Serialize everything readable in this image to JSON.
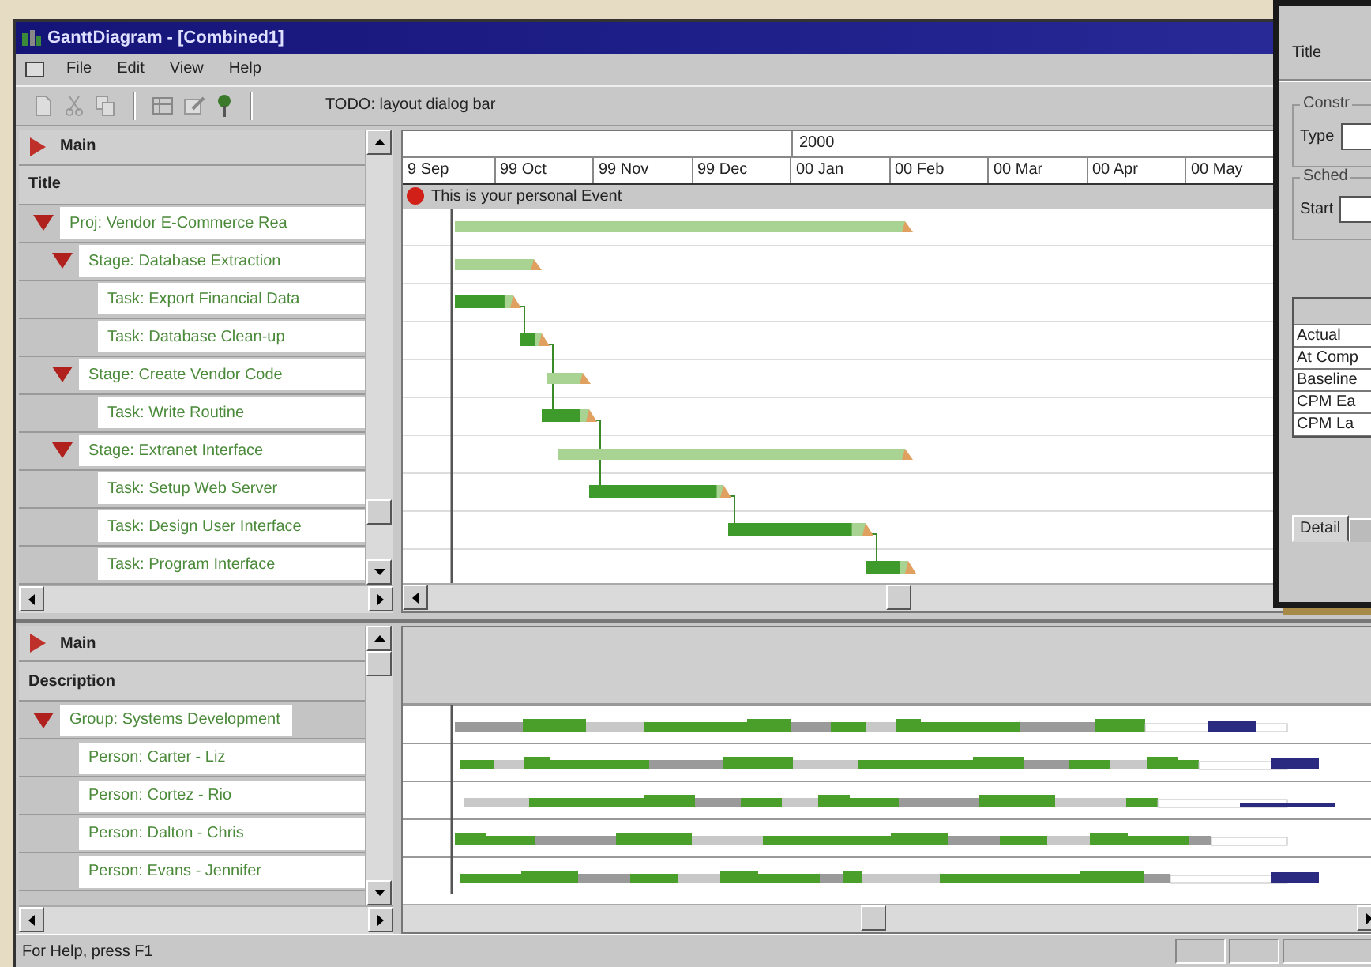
{
  "window": {
    "title": "GanttDiagram - [Combined1]"
  },
  "menu": [
    "File",
    "Edit",
    "View",
    "Help"
  ],
  "toolbar": {
    "dialog_bar": "TODO: layout dialog bar"
  },
  "upper_pane": {
    "header": {
      "group": "Main",
      "column": "Title"
    },
    "timeline": {
      "year": "2000",
      "months": [
        "9 Sep",
        "99 Oct",
        "99 Nov",
        "99 Dec",
        "00 Jan",
        "00 Feb",
        "00 Mar",
        "00 Apr",
        "00 May"
      ],
      "event": "This is your personal Event"
    },
    "tree": [
      {
        "label": "Proj: Vendor E-Commerce Rea",
        "expanded": true,
        "bar": {
          "kind": "summary"
        },
        "children": [
          {
            "label": "Stage: Database Extraction",
            "expanded": true,
            "bar": {
              "kind": "summary"
            },
            "children": [
              {
                "label": "Task: Export Financial Data",
                "bar": {
                  "kind": "task",
                  "level": 0.85
                }
              },
              {
                "label": "Task: Database Clean-up",
                "bar": {
                  "kind": "task",
                  "level": 0.7
                }
              }
            ]
          },
          {
            "label": "Stage: Create Vendor Code",
            "expanded": true,
            "bar": {
              "kind": "summary"
            },
            "children": [
              {
                "label": "Task: Write Routine",
                "bar": {
                  "kind": "task",
                  "level": 0.8
                }
              }
            ]
          },
          {
            "label": "Stage: Extranet Interface",
            "expanded": true,
            "bar": {
              "kind": "summary"
            },
            "children": [
              {
                "label": "Task: Setup Web Server",
                "bar": {
                  "kind": "task",
                  "level": 0.95
                }
              },
              {
                "label": "Task: Design User Interface",
                "bar": {
                  "kind": "task",
                  "level": 0.9
                }
              },
              {
                "label": "Task: Program Interface",
                "bar": {
                  "kind": "task",
                  "level": 0.8
                }
              }
            ]
          }
        ]
      }
    ]
  },
  "lower_pane": {
    "header": {
      "group": "Main",
      "column": "Description"
    },
    "tree": [
      {
        "label": "Group: Systems Development",
        "expanded": true,
        "children": [
          {
            "label": "Person: Carter - Liz"
          },
          {
            "label": "Person: Cortez - Rio"
          },
          {
            "label": "Person: Dalton - Chris"
          },
          {
            "label": "Person: Evans - Jennifer"
          }
        ]
      }
    ]
  },
  "dialog": {
    "title_label": "Title",
    "groups": [
      {
        "caption": "Constr",
        "field_label": "Type"
      },
      {
        "caption": "Sched",
        "field_label": "Start"
      }
    ],
    "list_rows": [
      "Actual",
      "At Comp",
      "Baseline",
      "CPM Ea",
      "CPM La"
    ],
    "tabs": [
      {
        "label": "Detail",
        "selected": true
      }
    ]
  },
  "status_bar": {
    "text": "For Help, press F1"
  }
}
